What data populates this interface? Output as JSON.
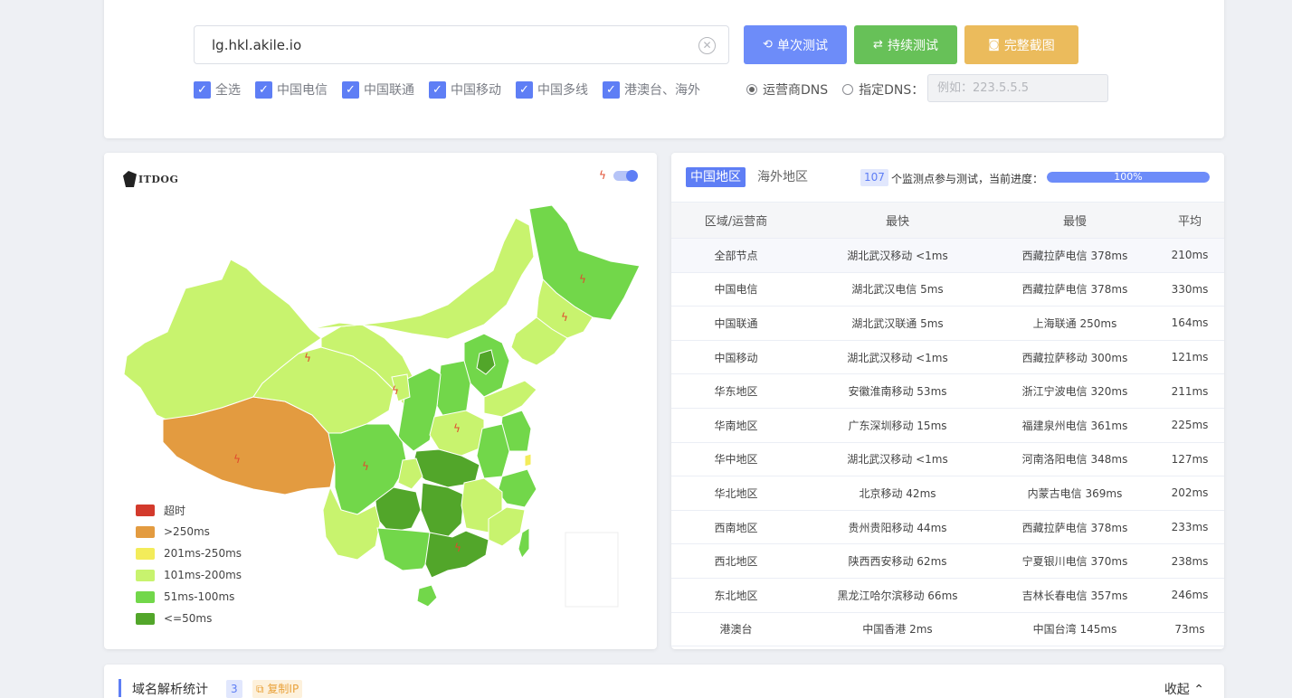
{
  "search": {
    "url_value": "lg.hkl.akile.io"
  },
  "buttons": {
    "single": "单次测试",
    "continuous": "持续测试",
    "screenshot": "完整截图"
  },
  "checkboxes": [
    "全选",
    "中国电信",
    "中国联通",
    "中国移动",
    "中国多线",
    "港澳台、海外"
  ],
  "dns": {
    "carrier_label": "运营商DNS",
    "custom_label": "指定DNS：",
    "custom_placeholder": "例如：223.5.5.5"
  },
  "map": {
    "logo_text": "ITDOG",
    "legend": [
      {
        "label": "超时",
        "color": "#d33a2c"
      },
      {
        "label": ">250ms",
        "color": "#e39b40"
      },
      {
        "label": "201ms-250ms",
        "color": "#f3ec5a"
      },
      {
        "label": "101ms-200ms",
        "color": "#c8f36e"
      },
      {
        "label": "51ms-100ms",
        "color": "#72d74a"
      },
      {
        "label": "<=50ms",
        "color": "#52a62a"
      }
    ]
  },
  "table": {
    "tabs": [
      "中国地区",
      "海外地区"
    ],
    "node_count": "107",
    "progress_text": "个监测点参与测试，当前进度：",
    "progress_value": "100%",
    "progress_fraction": 1.0,
    "headers": [
      "区域/运营商",
      "最快",
      "最慢",
      "平均"
    ],
    "rows": [
      [
        "全部节点",
        "湖北武汉移动 <1ms",
        "西藏拉萨电信 378ms",
        "210ms"
      ],
      [
        "中国电信",
        "湖北武汉电信 5ms",
        "西藏拉萨电信 378ms",
        "330ms"
      ],
      [
        "中国联通",
        "湖北武汉联通 5ms",
        "上海联通 250ms",
        "164ms"
      ],
      [
        "中国移动",
        "湖北武汉移动 <1ms",
        "西藏拉萨移动 300ms",
        "121ms"
      ],
      [
        "华东地区",
        "安徽淮南移动 53ms",
        "浙江宁波电信 320ms",
        "211ms"
      ],
      [
        "华南地区",
        "广东深圳移动 15ms",
        "福建泉州电信 361ms",
        "225ms"
      ],
      [
        "华中地区",
        "湖北武汉移动 <1ms",
        "河南洛阳电信 348ms",
        "127ms"
      ],
      [
        "华北地区",
        "北京移动 42ms",
        "内蒙古电信 369ms",
        "202ms"
      ],
      [
        "西南地区",
        "贵州贵阳移动 44ms",
        "西藏拉萨电信 378ms",
        "233ms"
      ],
      [
        "西北地区",
        "陕西西安移动 62ms",
        "宁夏银川电信 370ms",
        "238ms"
      ],
      [
        "东北地区",
        "黑龙江哈尔滨移动 66ms",
        "吉林长春电信 357ms",
        "246ms"
      ],
      [
        "港澳台",
        "中国香港 2ms",
        "中国台湾 145ms",
        "73ms"
      ]
    ]
  },
  "bottom": {
    "title": "域名解析统计",
    "count": "3",
    "copy_label": "复制IP",
    "collapse_label": "收起"
  }
}
